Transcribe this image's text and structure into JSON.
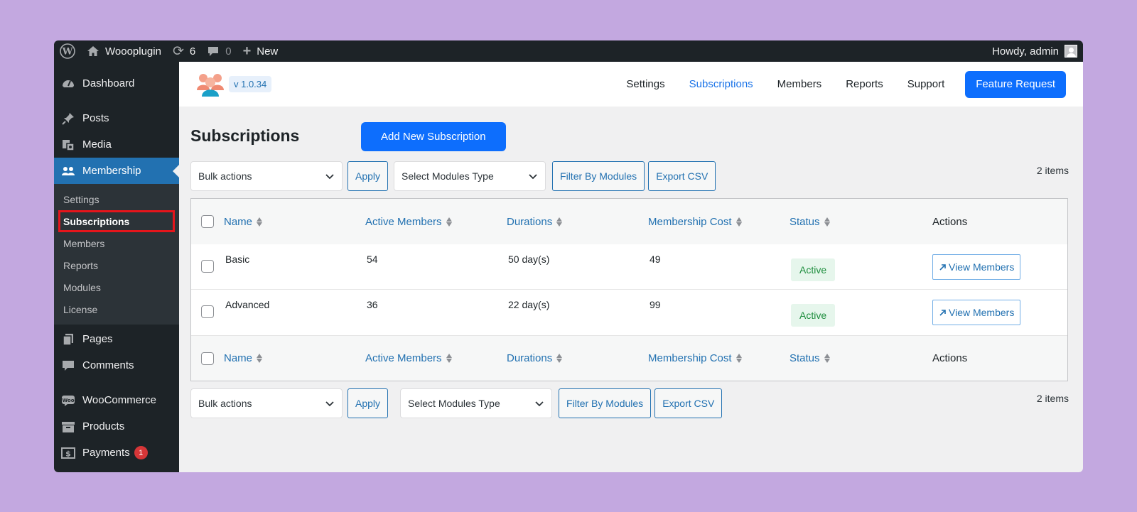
{
  "adminbar": {
    "site_name": "Woooplugin",
    "updates_count": "6",
    "comments_count": "0",
    "new_label": "New",
    "howdy": "Howdy, admin"
  },
  "sidebar": {
    "items": [
      {
        "label": "Dashboard",
        "icon": "dashboard-icon"
      },
      {
        "label": "Posts",
        "icon": "pin-icon"
      },
      {
        "label": "Media",
        "icon": "media-icon"
      },
      {
        "label": "Membership",
        "icon": "users-icon"
      }
    ],
    "submenu": [
      "Settings",
      "Subscriptions",
      "Members",
      "Reports",
      "Modules",
      "License"
    ],
    "items_after": [
      {
        "label": "Pages",
        "icon": "pages-icon"
      },
      {
        "label": "Comments",
        "icon": "comment-icon"
      },
      {
        "label": "WooCommerce",
        "icon": "woo-icon"
      },
      {
        "label": "Products",
        "icon": "archive-icon"
      },
      {
        "label": "Payments",
        "icon": "payments-icon",
        "badge": "1"
      }
    ]
  },
  "header": {
    "version": "v 1.0.34",
    "nav": [
      "Settings",
      "Subscriptions",
      "Members",
      "Reports",
      "Support"
    ],
    "feature_request": "Feature Request"
  },
  "page": {
    "title": "Subscriptions",
    "add_new": "Add New Subscription",
    "bulk_actions": "Bulk actions",
    "apply": "Apply",
    "modules_select": "Select Modules Type",
    "filter_btn": "Filter By Modules",
    "export_btn": "Export CSV",
    "items_count": "2 items"
  },
  "table": {
    "columns": [
      "Name",
      "Active Members",
      "Durations",
      "Membership Cost",
      "Status",
      "Actions"
    ],
    "rows": [
      {
        "name": "Basic",
        "members": "54",
        "duration": "50 day(s)",
        "cost": "49",
        "status": "Active",
        "action": "View Members"
      },
      {
        "name": "Advanced",
        "members": "36",
        "duration": "22 day(s)",
        "cost": "99",
        "status": "Active",
        "action": "View Members"
      }
    ]
  },
  "colors": {
    "accent": "#2271b1",
    "primary_button": "#0d6efd",
    "admin_dark": "#1d2327",
    "status_active": "#1e8e3e",
    "highlight": "#e5151b"
  }
}
